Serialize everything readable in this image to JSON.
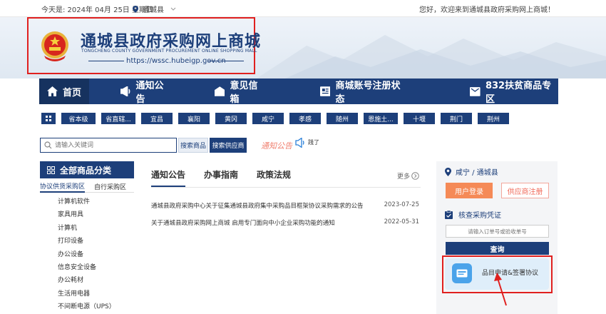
{
  "topbar": {
    "date": "今天是: 2024年 04月 25日 星期四",
    "location": "通城县",
    "welcome": "您好，欢迎来到通城县政府采购网上商城！"
  },
  "header": {
    "title": "通城县政府采购网上商城",
    "subtitle": "TONGCHENG COUNTY GOVERNMENT PROCUREMENT ONLINE SHOPPING MALL",
    "url": "https://wssc.hubeigp.gov.cn"
  },
  "nav": {
    "items": [
      {
        "label": "首页",
        "icon": "home-icon"
      },
      {
        "label": "通知公告",
        "icon": "megaphone-icon"
      },
      {
        "label": "意见信箱",
        "icon": "mailbox-icon"
      },
      {
        "label": "商城账号注册状态",
        "icon": "register-icon"
      },
      {
        "label": "832扶贫商品专区",
        "icon": "gift-icon"
      }
    ]
  },
  "regions": [
    "省本级",
    "省直辖...",
    "宜昌",
    "襄阳",
    "黄冈",
    "咸宁",
    "孝感",
    "随州",
    "恩施土...",
    "十堰",
    "荆门",
    "荆州"
  ],
  "search": {
    "placeholder": "请输入关键词",
    "goods_label": "搜索商品",
    "supplier_label": "搜索供应商",
    "marquee_label": "通知公告",
    "marquee_text": "践了"
  },
  "categories": {
    "title": "全部商品分类",
    "tabs": [
      "协议供货采购区",
      "自行采购区"
    ],
    "items": [
      "计算机软件",
      "家具用具",
      "计算机",
      "打印设备",
      "办公设备",
      "信息安全设备",
      "办公耗材",
      "生活用电器",
      "不间断电源（UPS）"
    ]
  },
  "notices": {
    "tabs": [
      "通知公告",
      "办事指南",
      "政策法规"
    ],
    "more_label": "更多",
    "rows": [
      {
        "title": "通城县政府采购中心关于征集通城县政府集中采购品目框架协议采购需求的公告",
        "date": "2023-07-25"
      },
      {
        "title": "关于通城县政府采购网上商城 启用专门面向中小企业采购功能的通知",
        "date": "2022-05-31"
      }
    ]
  },
  "right_panel": {
    "location": "咸宁 / 通城县",
    "user_login_label": "用户登录",
    "supplier_register_label": "供应商注册",
    "check_title": "核查采购凭证",
    "order_placeholder": "请输入订单号或验收单号",
    "query_label": "查询",
    "apply_label": "品目申请&签署协议"
  },
  "colors": {
    "brand_navy": "#1d3f7a",
    "highlight_red": "#e0201f",
    "login_orange": "#f58a57"
  }
}
